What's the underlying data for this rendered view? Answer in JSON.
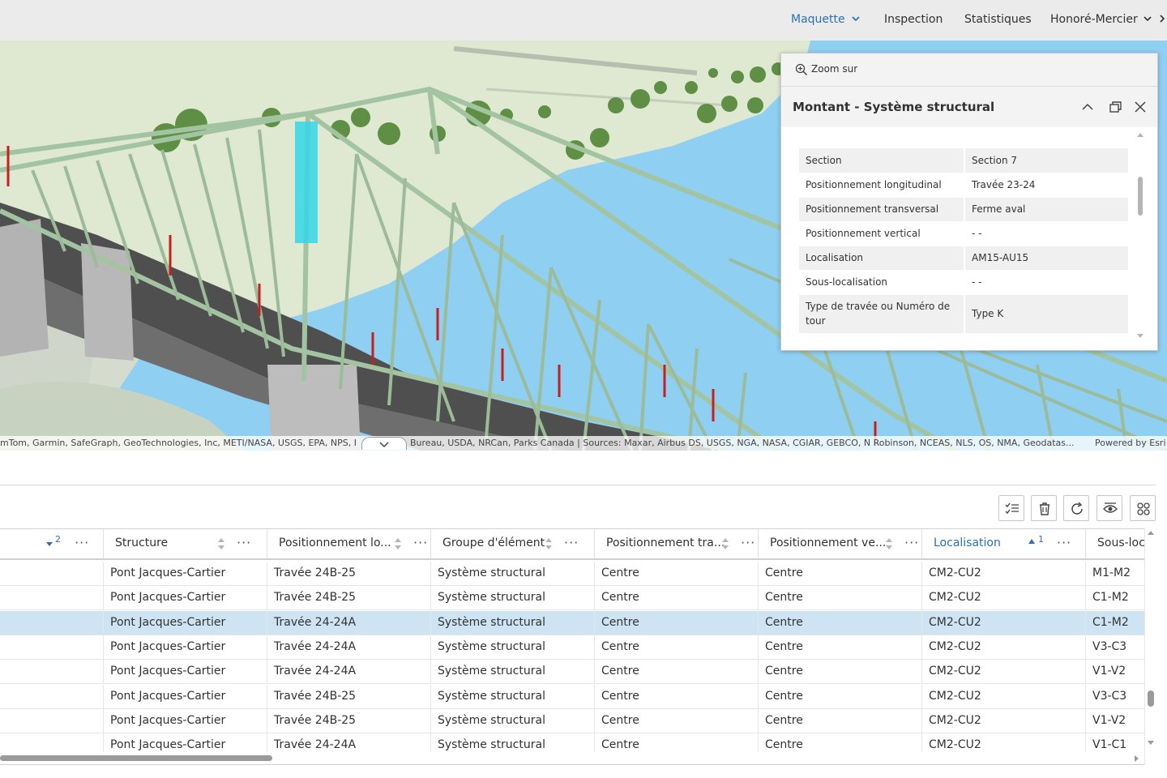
{
  "nav": {
    "items": [
      {
        "label": "Maquette",
        "active": true
      },
      {
        "label": "Inspection"
      },
      {
        "label": "Statistiques"
      },
      {
        "label": "Honoré-Mercier"
      }
    ]
  },
  "map": {
    "attribution_left": "mTom, Garmin, SafeGraph, GeoTechnologies, Inc, METI/NASA, USGS, EPA, NPS, I",
    "attribution_right": "Bureau, USDA, NRCan, Parks Canada | Sources: Maxar, Airbus DS, USGS, NGA, NASA, CGIAR, GEBCO, N Robinson, NCEAS, NLS, OS, NMA, Geodatas...",
    "powered_by": "Powered by Esri"
  },
  "popup": {
    "zoom_label": "Zoom sur",
    "title": "Montant - Système structural",
    "attributes": [
      {
        "key": "Section",
        "value": "Section 7"
      },
      {
        "key": "Positionnement longitudinal",
        "value": "Travée 23-24"
      },
      {
        "key": "Positionnement transversal",
        "value": "Ferme aval"
      },
      {
        "key": "Positionnement vertical",
        "value": "- -"
      },
      {
        "key": "Localisation",
        "value": "AM15-AU15"
      },
      {
        "key": "Sous-localisation",
        "value": "- -"
      },
      {
        "key": "Type de travée ou Numéro de tour",
        "value": "Type K"
      }
    ]
  },
  "table": {
    "columns": [
      {
        "label": "",
        "sort_badge": "2"
      },
      {
        "label": "Structure"
      },
      {
        "label": "Positionnement lo..."
      },
      {
        "label": "Groupe d'élément"
      },
      {
        "label": "Positionnement tra..."
      },
      {
        "label": "Positionnement ve..."
      },
      {
        "label": "Localisation",
        "sort_badge": "1"
      },
      {
        "label": "Sous-loca"
      }
    ],
    "rows": [
      {
        "structure": "Pont Jacques-Cartier",
        "longitudinal": "Travée 24B-25",
        "groupe": "Système structural",
        "transversal": "Centre",
        "vertical": "Centre",
        "localisation": "CM2-CU2",
        "sous_loc": "M1-M2",
        "selected": false
      },
      {
        "structure": "Pont Jacques-Cartier",
        "longitudinal": "Travée 24B-25",
        "groupe": "Système structural",
        "transversal": "Centre",
        "vertical": "Centre",
        "localisation": "CM2-CU2",
        "sous_loc": "C1-M2",
        "selected": false
      },
      {
        "structure": "Pont Jacques-Cartier",
        "longitudinal": "Travée 24-24A",
        "groupe": "Système structural",
        "transversal": "Centre",
        "vertical": "Centre",
        "localisation": "CM2-CU2",
        "sous_loc": "C1-M2",
        "selected": true
      },
      {
        "structure": "Pont Jacques-Cartier",
        "longitudinal": "Travée 24-24A",
        "groupe": "Système structural",
        "transversal": "Centre",
        "vertical": "Centre",
        "localisation": "CM2-CU2",
        "sous_loc": "V3-C3",
        "selected": false
      },
      {
        "structure": "Pont Jacques-Cartier",
        "longitudinal": "Travée 24-24A",
        "groupe": "Système structural",
        "transversal": "Centre",
        "vertical": "Centre",
        "localisation": "CM2-CU2",
        "sous_loc": "V1-V2",
        "selected": false
      },
      {
        "structure": "Pont Jacques-Cartier",
        "longitudinal": "Travée 24B-25",
        "groupe": "Système structural",
        "transversal": "Centre",
        "vertical": "Centre",
        "localisation": "CM2-CU2",
        "sous_loc": "V3-C3",
        "selected": false
      },
      {
        "structure": "Pont Jacques-Cartier",
        "longitudinal": "Travée 24B-25",
        "groupe": "Système structural",
        "transversal": "Centre",
        "vertical": "Centre",
        "localisation": "CM2-CU2",
        "sous_loc": "V1-V2",
        "selected": false
      },
      {
        "structure": "Pont Jacques-Cartier",
        "longitudinal": "Travée 24-24A",
        "groupe": "Système structural",
        "transversal": "Centre",
        "vertical": "Centre",
        "localisation": "CM2-CU2",
        "sous_loc": "V1-C1",
        "selected": false
      }
    ],
    "toolbar_icons": [
      "show-selection-icon",
      "delete-selection-icon",
      "refresh-icon",
      "toggle-visibility-icon",
      "options-grid-icon"
    ]
  },
  "colors": {
    "accent": "#2b6fb6",
    "selected_row": "#cfe4f2",
    "bridge_steel": "#a3c4a0",
    "water": "#8fcff2",
    "highlight": "#35d6e8"
  }
}
